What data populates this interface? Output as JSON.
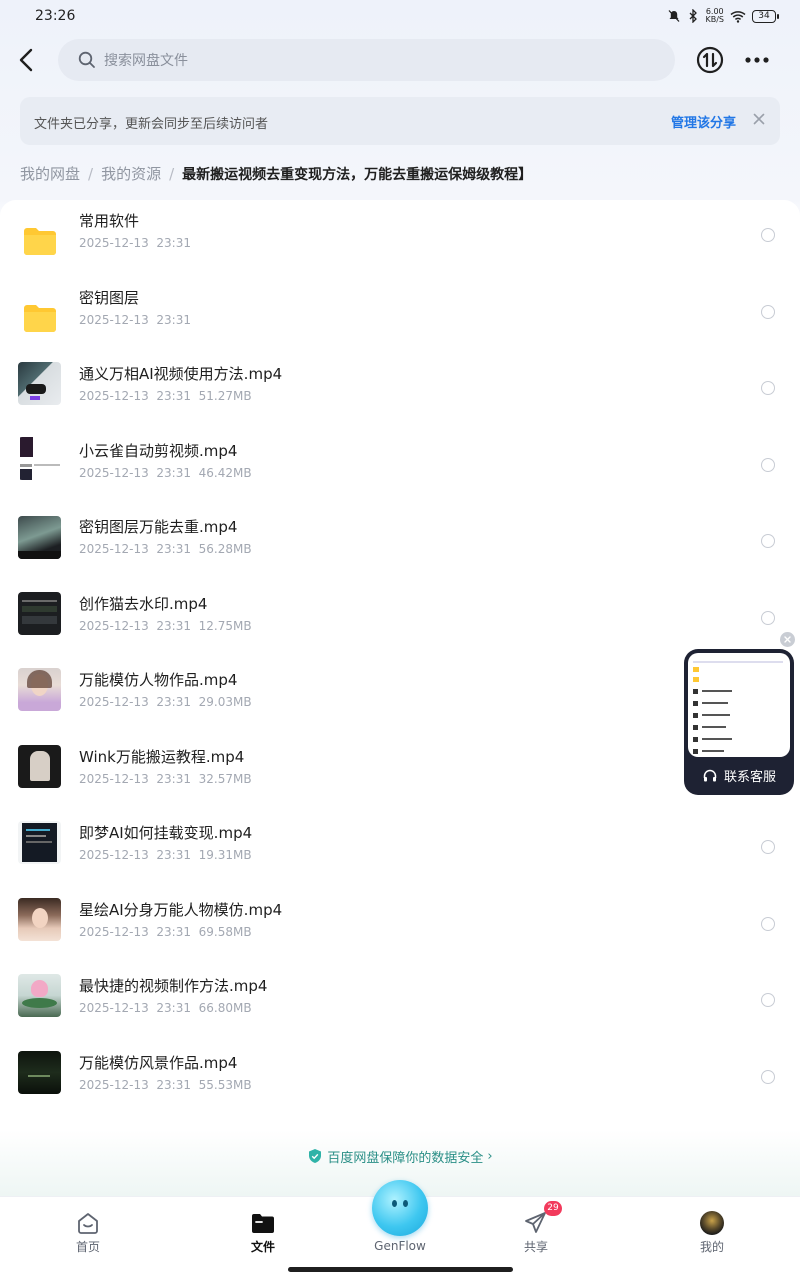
{
  "status_bar": {
    "time": "23:26",
    "net_speed_value": "6.00",
    "net_speed_unit": "KB/S",
    "battery": "34"
  },
  "header": {
    "search_placeholder": "搜索网盘文件"
  },
  "notice": {
    "text": "文件夹已分享，更新会同步至后续访问者",
    "link": "管理该分享"
  },
  "breadcrumb": {
    "items": [
      "我的网盘",
      "我的资源"
    ],
    "separator": "/",
    "current": "最新搬运视频去重变现方法，万能去重搬运保姆级教程】"
  },
  "files": [
    {
      "name": "常用软件",
      "date": "2025-12-13",
      "time": "23:31",
      "size": "",
      "kind": "folder"
    },
    {
      "name": "密钥图层",
      "date": "2025-12-13",
      "time": "23:31",
      "size": "",
      "kind": "folder"
    },
    {
      "name": "通义万相AI视频使用方法.mp4",
      "date": "2025-12-13",
      "time": "23:31",
      "size": "51.27MB",
      "kind": "video"
    },
    {
      "name": "小云雀自动剪视频.mp4",
      "date": "2025-12-13",
      "time": "23:31",
      "size": "46.42MB",
      "kind": "video"
    },
    {
      "name": "密钥图层万能去重.mp4",
      "date": "2025-12-13",
      "time": "23:31",
      "size": "56.28MB",
      "kind": "video"
    },
    {
      "name": "创作猫去水印.mp4",
      "date": "2025-12-13",
      "time": "23:31",
      "size": "12.75MB",
      "kind": "video"
    },
    {
      "name": "万能模仿人物作品.mp4",
      "date": "2025-12-13",
      "time": "23:31",
      "size": "29.03MB",
      "kind": "video"
    },
    {
      "name": "Wink万能搬运教程.mp4",
      "date": "2025-12-13",
      "time": "23:31",
      "size": "32.57MB",
      "kind": "video"
    },
    {
      "name": "即梦AI如何挂载变现.mp4",
      "date": "2025-12-13",
      "time": "23:31",
      "size": "19.31MB",
      "kind": "video"
    },
    {
      "name": "星绘AI分身万能人物模仿.mp4",
      "date": "2025-12-13",
      "time": "23:31",
      "size": "69.58MB",
      "kind": "video"
    },
    {
      "name": "最快捷的视频制作方法.mp4",
      "date": "2025-12-13",
      "time": "23:31",
      "size": "66.80MB",
      "kind": "video"
    },
    {
      "name": "万能模仿风景作品.mp4",
      "date": "2025-12-13",
      "time": "23:31",
      "size": "55.53MB",
      "kind": "video"
    }
  ],
  "service": {
    "label": "联系客服"
  },
  "security": {
    "text": "百度网盘保障你的数据安全",
    "arrow": "›"
  },
  "nav": {
    "items": [
      {
        "label": "首页",
        "icon": "home-icon"
      },
      {
        "label": "文件",
        "icon": "folder-icon"
      },
      {
        "label": "GenFlow",
        "icon": "genflow-icon"
      },
      {
        "label": "共享",
        "icon": "paper-plane-icon"
      },
      {
        "label": "我的",
        "icon": "avatar-icon"
      }
    ],
    "share_badge": "29"
  },
  "colors": {
    "accent": "#2277e6",
    "badge": "#f23a5c",
    "security": "#2b8f87",
    "folder": "#ffc832"
  }
}
